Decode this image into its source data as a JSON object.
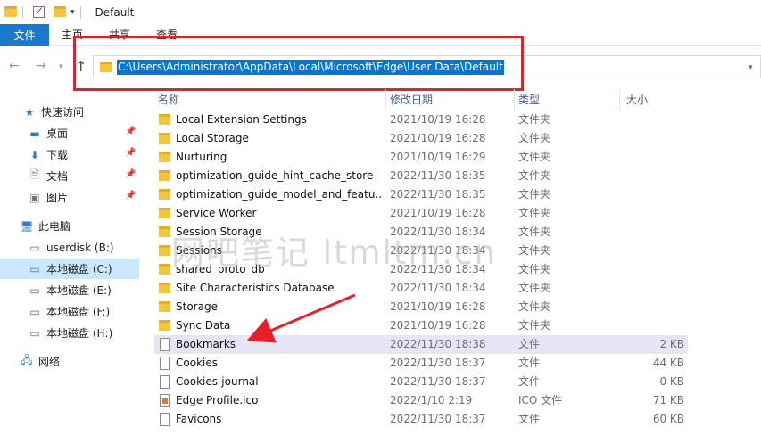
{
  "window": {
    "title": "Default"
  },
  "ribbon": {
    "tabs": [
      "文件",
      "主页",
      "共享",
      "查看"
    ]
  },
  "address": {
    "path": "C:\\Users\\Administrator\\AppData\\Local\\Microsoft\\Edge\\User Data\\Default"
  },
  "nav": {
    "quick_access": "快速访问",
    "desktop": "桌面",
    "downloads": "下载",
    "documents": "文档",
    "pictures": "图片",
    "this_pc": "此电脑",
    "drive_b": "userdisk (B:)",
    "drive_c": "本地磁盘 (C:)",
    "drive_e": "本地磁盘 (E:)",
    "drive_f": "本地磁盘 (F:)",
    "drive_h": "本地磁盘 (H:)",
    "network": "网络"
  },
  "columns": {
    "name": "名称",
    "date": "修改日期",
    "type": "类型",
    "size": "大小"
  },
  "files": [
    {
      "name": "Local Extension Settings",
      "date": "2021/10/19 16:28",
      "type": "文件夹",
      "size": "",
      "kind": "folder"
    },
    {
      "name": "Local Storage",
      "date": "2021/10/19 16:28",
      "type": "文件夹",
      "size": "",
      "kind": "folder"
    },
    {
      "name": "Nurturing",
      "date": "2021/10/19 16:29",
      "type": "文件夹",
      "size": "",
      "kind": "folder"
    },
    {
      "name": "optimization_guide_hint_cache_store",
      "date": "2022/11/30 18:35",
      "type": "文件夹",
      "size": "",
      "kind": "folder"
    },
    {
      "name": "optimization_guide_model_and_featu...",
      "date": "2022/11/30 18:35",
      "type": "文件夹",
      "size": "",
      "kind": "folder"
    },
    {
      "name": "Service Worker",
      "date": "2021/10/19 16:28",
      "type": "文件夹",
      "size": "",
      "kind": "folder"
    },
    {
      "name": "Session Storage",
      "date": "2022/11/30 18:34",
      "type": "文件夹",
      "size": "",
      "kind": "folder"
    },
    {
      "name": "Sessions",
      "date": "2022/11/30 18:34",
      "type": "文件夹",
      "size": "",
      "kind": "folder"
    },
    {
      "name": "shared_proto_db",
      "date": "2022/11/30 18:34",
      "type": "文件夹",
      "size": "",
      "kind": "folder"
    },
    {
      "name": "Site Characteristics Database",
      "date": "2022/11/30 18:34",
      "type": "文件夹",
      "size": "",
      "kind": "folder"
    },
    {
      "name": "Storage",
      "date": "2021/10/19 16:28",
      "type": "文件夹",
      "size": "",
      "kind": "folder"
    },
    {
      "name": "Sync Data",
      "date": "2021/10/19 16:28",
      "type": "文件夹",
      "size": "",
      "kind": "folder"
    },
    {
      "name": "Bookmarks",
      "date": "2022/11/30 18:38",
      "type": "文件",
      "size": "2 KB",
      "kind": "file"
    },
    {
      "name": "Cookies",
      "date": "2022/11/30 18:37",
      "type": "文件",
      "size": "44 KB",
      "kind": "file"
    },
    {
      "name": "Cookies-journal",
      "date": "2022/11/30 18:37",
      "type": "文件",
      "size": "0 KB",
      "kind": "file"
    },
    {
      "name": "Edge Profile.ico",
      "date": "2022/1/10 2:19",
      "type": "ICO 文件",
      "size": "71 KB",
      "kind": "ico"
    },
    {
      "name": "Favicons",
      "date": "2022/11/30 18:37",
      "type": "文件",
      "size": "60 KB",
      "kind": "file"
    }
  ],
  "watermark": "网吧笔记 ltmltm.cn",
  "colors": {
    "accent": "#1979ca",
    "selection": "#0078d7",
    "annotation": "#e5202a",
    "row_highlight": "#e5e5f5"
  }
}
